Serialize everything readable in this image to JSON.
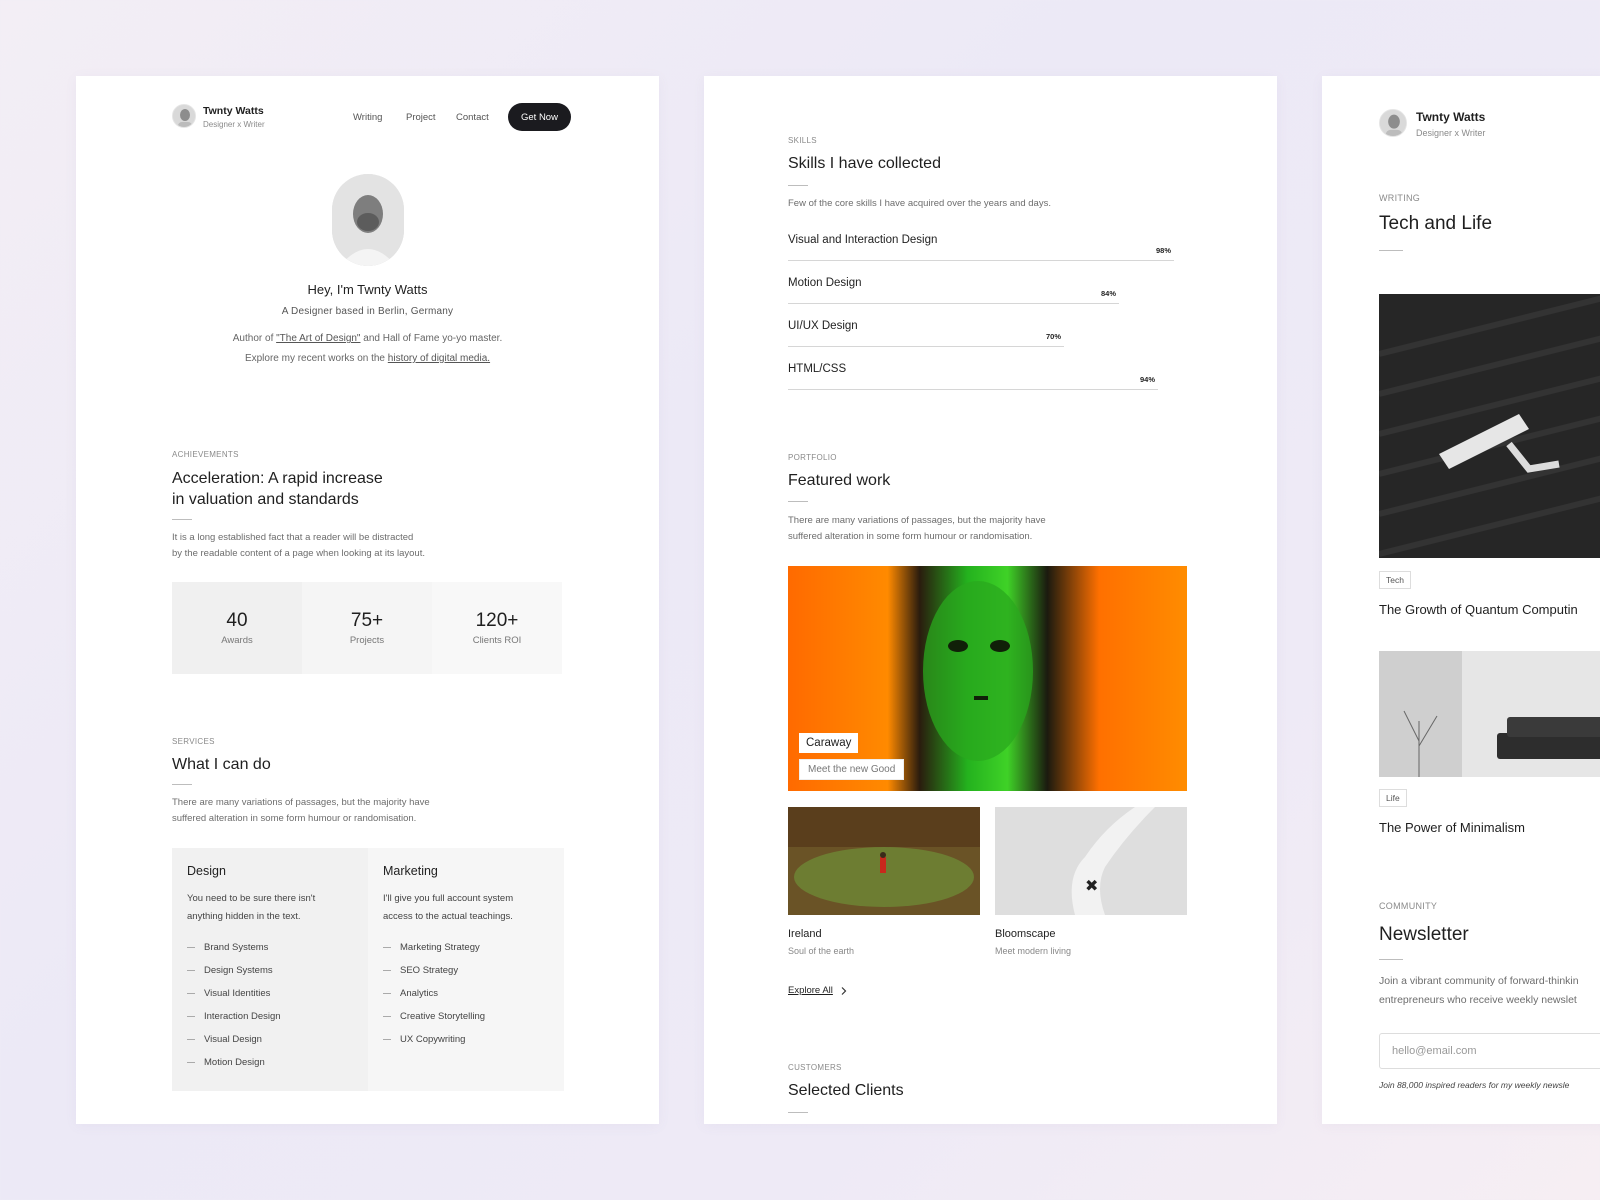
{
  "profile": {
    "name": "Twnty Watts",
    "tagline": "Designer x Writer",
    "nav": [
      "Writing",
      "Project",
      "Contact"
    ],
    "cta": "Get Now"
  },
  "hero": {
    "greeting": "Hey, I'm Twnty Watts",
    "role": "A Designer based in Berlin, Germany",
    "line1_pre": "Author of ",
    "line1_link": "\"The Art of Design\"",
    "line1_post": " and Hall of Fame yo-yo master.",
    "line2_pre": "Explore my recent works on the ",
    "line2_link": "history of digital media."
  },
  "achievements": {
    "label": "ACHIEVEMENTS",
    "title_line1": "Acceleration: A rapid increase",
    "title_line2": "in valuation and standards",
    "desc_line1": "It is a long established fact that a reader will be distracted",
    "desc_line2": "by the readable content of a page when looking at its layout.",
    "stats": [
      {
        "value": "40",
        "label": "Awards"
      },
      {
        "value": "75+",
        "label": "Projects"
      },
      {
        "value": "120+",
        "label": "Clients ROI"
      }
    ]
  },
  "services": {
    "label": "SERVICES",
    "title": "What I can do",
    "desc_line1": "There are many variations of passages, but the majority have",
    "desc_line2": "suffered alteration in some form humour or randomisation.",
    "columns": [
      {
        "title": "Design",
        "desc_line1": "You need to be sure there isn't",
        "desc_line2": "anything hidden in the text.",
        "items": [
          "Brand Systems",
          "Design Systems",
          "Visual Identities",
          "Interaction Design",
          "Visual Design",
          "Motion Design"
        ]
      },
      {
        "title": "Marketing",
        "desc_line1": "I'll give you full account system",
        "desc_line2": "access to the actual teachings.",
        "items": [
          "Marketing Strategy",
          "SEO Strategy",
          "Analytics",
          "Creative Storytelling",
          "UX Copywriting"
        ]
      }
    ]
  },
  "skills": {
    "label": "SKILLS",
    "title": "Skills I have collected",
    "desc": "Few of the core skills I have acquired over the years and days.",
    "items": [
      {
        "name": "Visual and Interaction Design",
        "pct_label": "98%",
        "level": 0.98
      },
      {
        "name": "Motion Design",
        "pct_label": "84%",
        "level": 0.84
      },
      {
        "name": "UI/UX Design",
        "pct_label": "70%",
        "level": 0.7
      },
      {
        "name": "HTML/CSS",
        "pct_label": "94%",
        "level": 0.94
      }
    ]
  },
  "portfolio": {
    "label": "PORTFOLIO",
    "title": "Featured work",
    "desc_line1": "There are many variations of passages, but the majority have",
    "desc_line2": "suffered alteration in some form humour or randomisation.",
    "featured": {
      "name": "Caraway",
      "sub": "Meet the new Good"
    },
    "projects": [
      {
        "name": "Ireland",
        "sub": "Soul of the earth"
      },
      {
        "name": "Bloomscape",
        "sub": "Meet modern living"
      }
    ],
    "explore": "Explore All"
  },
  "customers": {
    "label": "CUSTOMERS",
    "title": "Selected Clients"
  },
  "writing": {
    "label": "WRITING",
    "title": "Tech and Life",
    "articles": [
      {
        "tag": "Tech",
        "title": "The Growth of Quantum Computin"
      },
      {
        "tag": "Life",
        "title": "The Power of Minimalism"
      }
    ]
  },
  "community": {
    "label": "COMMUNITY",
    "title": "Newsletter",
    "desc_line1": "Join a vibrant community of forward-thinkin",
    "desc_line2": "entrepreneurs who receive weekly newslet",
    "email_placeholder": "hello@email.com",
    "note": "Join 88,000 inspired readers for my weekly newsle"
  },
  "colors": {
    "dark_button": "#1b1b1f",
    "accent_orange": "#ff7a00",
    "accent_green": "#2fbf1f"
  }
}
